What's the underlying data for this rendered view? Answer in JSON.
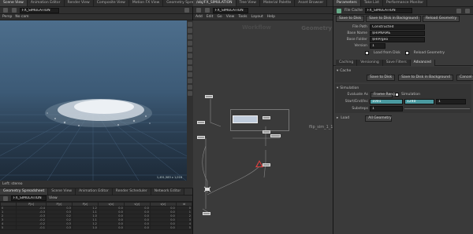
{
  "top_tabs_left": [
    "Scene View",
    "Animation Editor",
    "Render View",
    "Composite View",
    "Motion FX View",
    "Geometry Spreadsheet"
  ],
  "viewport": {
    "menu_label": "Persp",
    "cam_label": "No cam",
    "path": "FX_SIMULATION",
    "footer_text": "Left: stereo",
    "coords": "1,451,583 x 1,016"
  },
  "network": {
    "tabs": [
      "/obj/FX_SIMULATION",
      "Tree View",
      "Material Palette",
      "Asset Browser"
    ],
    "path": "FX_SIMULATION",
    "menus": [
      "Add",
      "Edit",
      "Go",
      "View",
      "Tools",
      "Layout",
      "Help"
    ],
    "context_label": "Geometry",
    "watermark": "Workflow",
    "node_labels": [
      "flip_sim_1_1",
      "",
      "",
      "",
      "",
      ""
    ]
  },
  "params": {
    "tabs": [
      "Parameters",
      "Take List",
      "Performance Monitor"
    ],
    "node_type": "File Cache",
    "node_name": "FX_SIMULATION",
    "top_buttons": [
      "Save to Disk",
      "Save to Disk in Background",
      "Reload Geometry"
    ],
    "rows": [
      {
        "label": "File Path",
        "value": "Constructed"
      },
      {
        "label": "Base Name",
        "value": "$HIPNAME"
      },
      {
        "label": "Base Folder",
        "value": "$HIP/geo"
      },
      {
        "label": "Version",
        "value": "1"
      }
    ],
    "toggles": [
      "Load from Disk",
      "Reload Geometry"
    ],
    "sub_tabs": [
      "Caching",
      "Versioning",
      "Save Filters",
      "Advanced"
    ],
    "section_label": "Cache",
    "action_buttons": [
      "Save to Disk",
      "Save to Disk in Background",
      "Cancel Cook"
    ],
    "section2_label": "Simulation",
    "eval_label": "Evaluate As",
    "eval_value": "Frame Range",
    "sim_check": "Simulation",
    "range_label": "Start/End/Inc",
    "range_values": [
      "1001",
      "1240",
      "1"
    ],
    "substeps_label": "Substeps",
    "substeps_value": "1",
    "load_label": "Load",
    "load_value": "All Geometry"
  },
  "bottom": {
    "tabs": [
      "Geometry Spreadsheet",
      "Scene View",
      "Animation Editor",
      "Render Scheduler",
      "Network Editor"
    ],
    "path": "FX_SIMULATION",
    "view_label": "View",
    "columns": [
      "",
      "P[x]",
      "P[y]",
      "P[z]",
      "v[x]",
      "v[y]",
      "v[z]",
      "id"
    ],
    "rows": [
      [
        "0",
        "-0.4",
        "0.3",
        "1.2",
        "0.0",
        "0.0",
        "0.0",
        "0"
      ],
      [
        "1",
        "-0.3",
        "0.3",
        "1.1",
        "0.0",
        "0.0",
        "0.0",
        "1"
      ],
      [
        "2",
        "-0.3",
        "0.2",
        "1.0",
        "0.0",
        "0.0",
        "0.0",
        "2"
      ],
      [
        "3",
        "-0.2",
        "0.2",
        "1.1",
        "0.0",
        "0.0",
        "0.0",
        "3"
      ],
      [
        "4",
        "-0.2",
        "0.3",
        "1.2",
        "0.0",
        "0.0",
        "0.0",
        "4"
      ],
      [
        "5",
        "-0.1",
        "0.3",
        "1.0",
        "0.0",
        "0.0",
        "0.0",
        "5"
      ]
    ]
  },
  "colors": {
    "accent_teal": "#4a9aa0",
    "selection_blue": "#c0ccdc",
    "warning_red": "#e04040"
  }
}
